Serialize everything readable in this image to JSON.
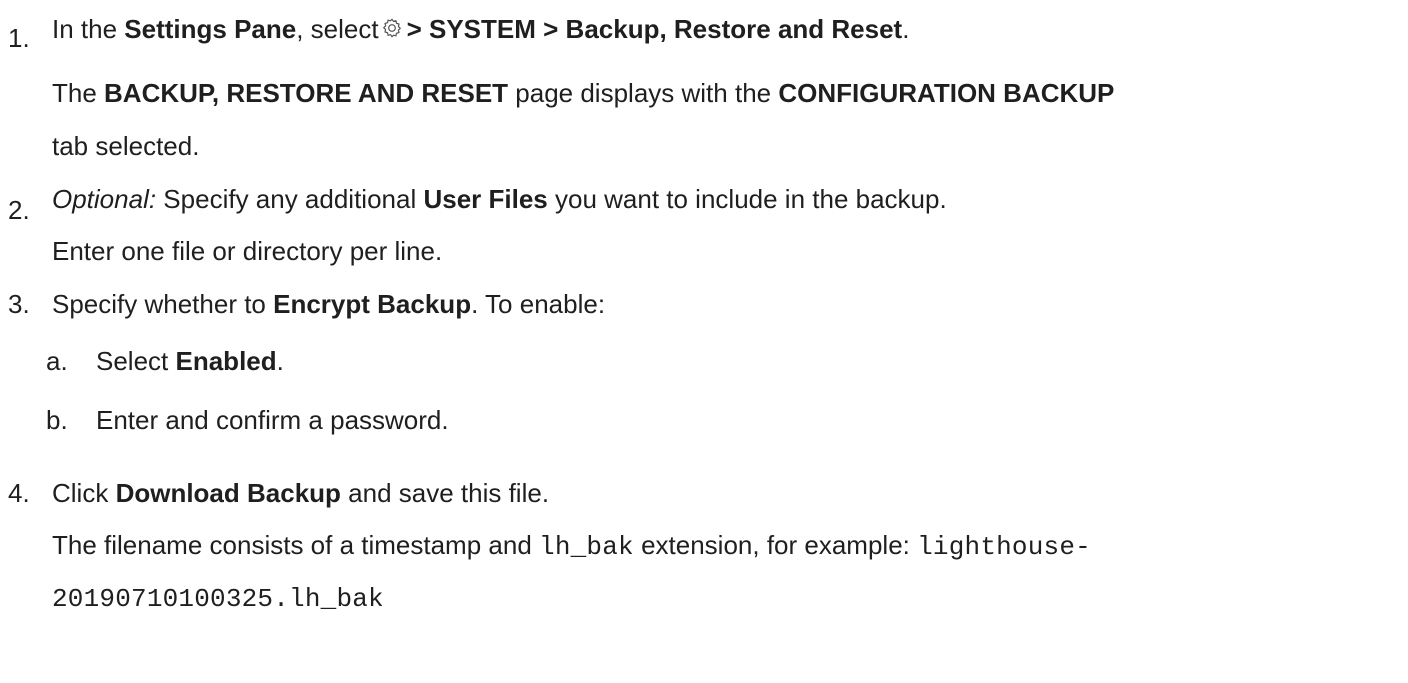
{
  "steps": [
    {
      "number": "1.",
      "line1": {
        "t1": "In the ",
        "b1": "Settings Pane",
        "t2": ", select",
        "icon": "gear-icon",
        "b2": "> SYSTEM > Backup, Restore and Reset",
        "t3": "."
      },
      "line2": {
        "t1": "The ",
        "b1": "BACKUP, RESTORE AND RESET",
        "t2": " page displays with the ",
        "b2": "CONFIGURATION BACKUP"
      },
      "line3": "tab selected."
    },
    {
      "number": "2.",
      "line1": {
        "i1": "Optional:",
        "t1": " Specify any additional ",
        "b1": "User Files",
        "t2": " you want to include in the backup."
      },
      "line2": "Enter one file or directory per line."
    },
    {
      "number": "3.",
      "line1": {
        "t1": "Specify whether to ",
        "b1": "Encrypt Backup",
        "t2": ". To enable:"
      },
      "substeps": [
        {
          "letter": "a.",
          "t1": "Select ",
          "b1": "Enabled",
          "t2": "."
        },
        {
          "letter": "b.",
          "t1": "Enter and confirm a password."
        }
      ]
    },
    {
      "number": "4.",
      "line1": {
        "t1": "Click ",
        "b1": "Download Backup",
        "t2": " and save this file."
      },
      "line2": {
        "t1": "The filename consists of a timestamp and ",
        "c1": "lh_bak",
        "t2": " extension, for example: ",
        "c2": "lighthouse-"
      },
      "line3": {
        "c1": "20190710100325.lh_bak"
      }
    }
  ]
}
